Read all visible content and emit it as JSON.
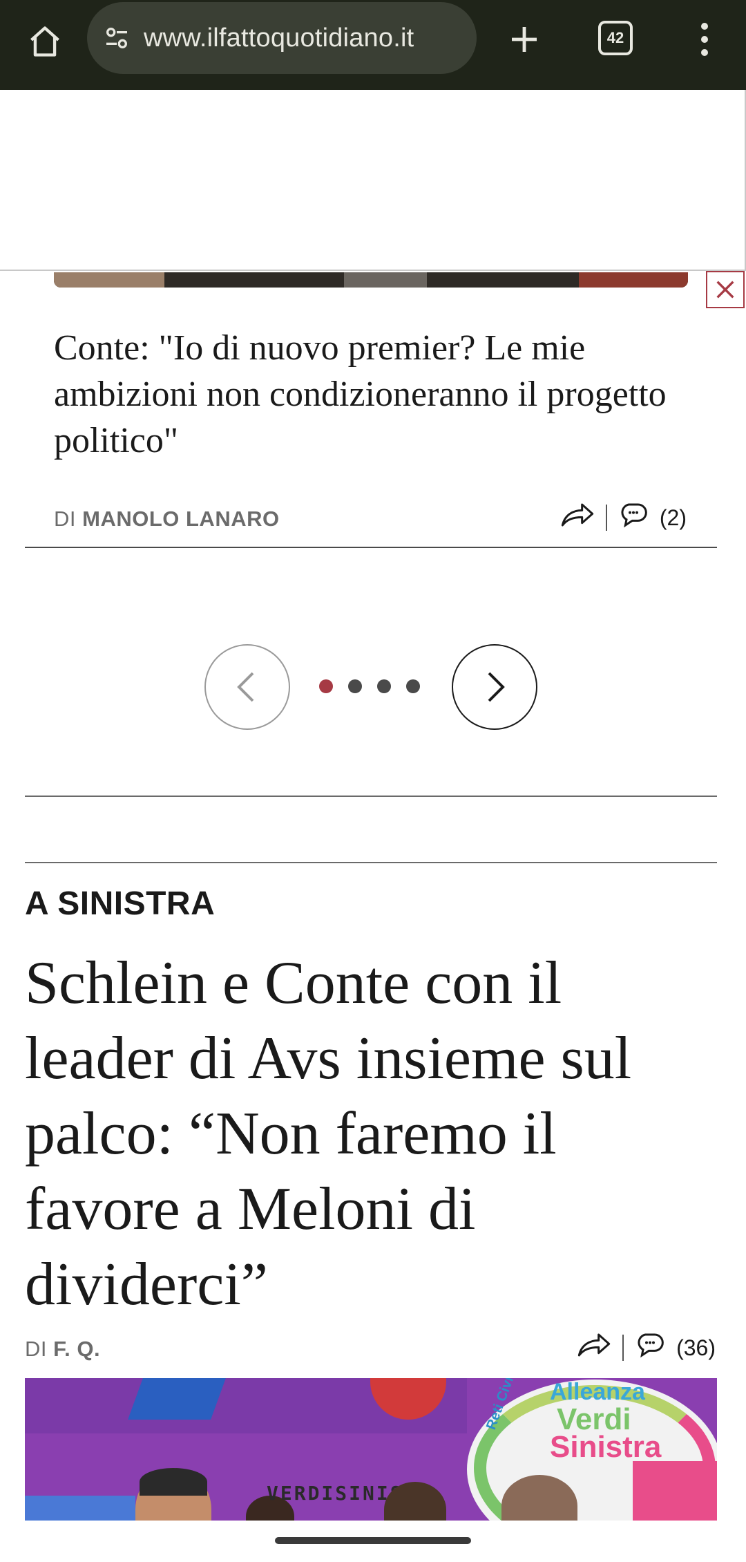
{
  "browser": {
    "url": "www.ilfattoquotidiano.it",
    "tab_count": "42",
    "icons": [
      "home-icon",
      "site-settings-icon",
      "new-tab-icon",
      "tab-switcher-icon",
      "overflow-menu-icon"
    ]
  },
  "ad": {
    "close_icon": "close-icon"
  },
  "carousel_article": {
    "title": "Conte: \"Io di nuovo premier? Le mie ambizioni non condizioneranno il progetto politico\"",
    "byline_prefix": "DI",
    "author": "MANOLO LANARO",
    "comment_count": "(2)",
    "icons": [
      "share-icon",
      "comments-icon"
    ]
  },
  "carousel": {
    "page_count": 4,
    "active_index": 0,
    "colors": {
      "active": "#a63a44",
      "inactive": "#4a4a4a"
    }
  },
  "main_article": {
    "kicker": "A SINISTRA",
    "title": "Schlein e Conte con il leader di Avs insieme sul palco: “Non faremo il favore a Meloni di dividerci”",
    "byline_prefix": "DI",
    "author": "F. Q.",
    "comment_count": "(36)"
  },
  "photo": {
    "logo_line1": "Alleanza",
    "logo_line2": "Verdi",
    "logo_line3": "Sinistra",
    "logo_arc": "Reti Civiche",
    "banner_fragment": "VERDISINIS"
  }
}
